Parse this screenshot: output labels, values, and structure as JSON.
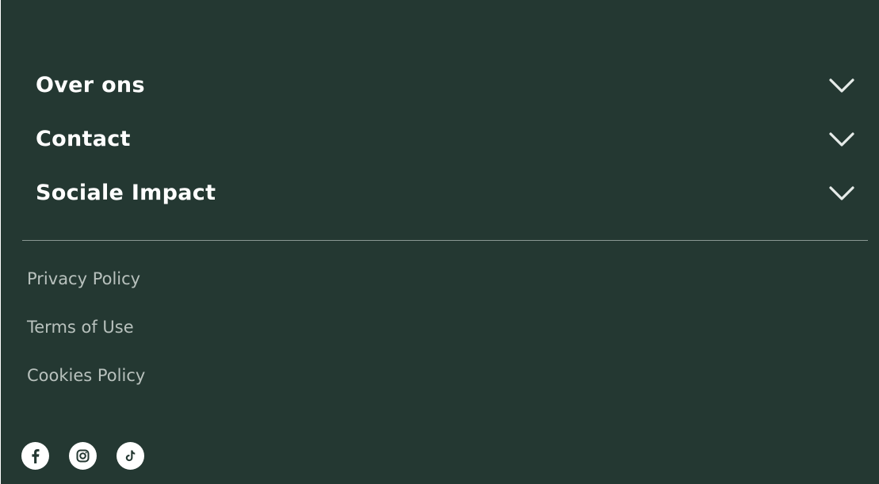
{
  "footer": {
    "accordion": [
      {
        "label": "Over ons",
        "icon": "chevron-down-icon"
      },
      {
        "label": "Contact",
        "icon": "chevron-down-icon"
      },
      {
        "label": "Sociale Impact",
        "icon": "chevron-down-icon"
      }
    ],
    "legal_links": [
      {
        "label": "Privacy Policy"
      },
      {
        "label": "Terms of Use"
      },
      {
        "label": "Cookies Policy"
      }
    ],
    "social": [
      {
        "icon": "facebook-icon"
      },
      {
        "icon": "instagram-icon"
      },
      {
        "icon": "tiktok-icon"
      }
    ],
    "colors": {
      "background": "#243832",
      "heading_text": "#ffffff",
      "link_text": "#b8c1bd",
      "divider": "#8a9893",
      "social_circle": "#ffffff"
    }
  }
}
